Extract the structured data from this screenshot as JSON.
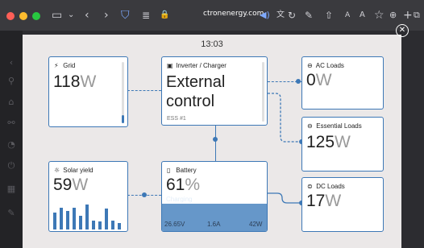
{
  "browser": {
    "url_host": "ctronenergy.com",
    "address_prefix": "⌂",
    "colors": {
      "close": "#ff5f57",
      "minimize": "#febc2e",
      "zoom": "#28c840"
    },
    "toolbar_icons": [
      "sidebar-icon",
      "chevron-down-icon",
      "back-icon",
      "forward-icon",
      "shield-icon",
      "reader-icon",
      "audio-icon",
      "translate-icon",
      "reload-icon",
      "note-icon",
      "share-icon",
      "text-small-icon",
      "text-large-icon",
      "bookmark-icon",
      "download-icon",
      "new-tab-icon",
      "tabs-icon",
      "more-icon"
    ]
  },
  "dashboard": {
    "time": "13:03",
    "grid": {
      "title": "Grid",
      "value": "118",
      "unit": "W"
    },
    "inverter": {
      "title": "Inverter / Charger",
      "status_line1": "External",
      "status_line2": "control",
      "subtitle": "ESS #1"
    },
    "ac_loads": {
      "title": "AC Loads",
      "value": "0",
      "unit": "W"
    },
    "essential_loads": {
      "title": "Essential Loads",
      "value": "125",
      "unit": "W"
    },
    "solar": {
      "title": "Solar yield",
      "value": "59",
      "unit": "W",
      "bars": [
        0.55,
        0.72,
        0.6,
        0.72,
        0.45,
        0.82,
        0.3,
        0.25,
        0.68,
        0.28,
        0.2
      ]
    },
    "battery": {
      "title": "Battery",
      "value": "61",
      "unit": "%",
      "state": "Charging",
      "voltage": "26.65V",
      "current": "1.6A",
      "power": "42W",
      "level": 0.61
    },
    "dc_loads": {
      "title": "DC Loads",
      "value": "17",
      "unit": "W"
    },
    "accent": "#3d78b6"
  }
}
